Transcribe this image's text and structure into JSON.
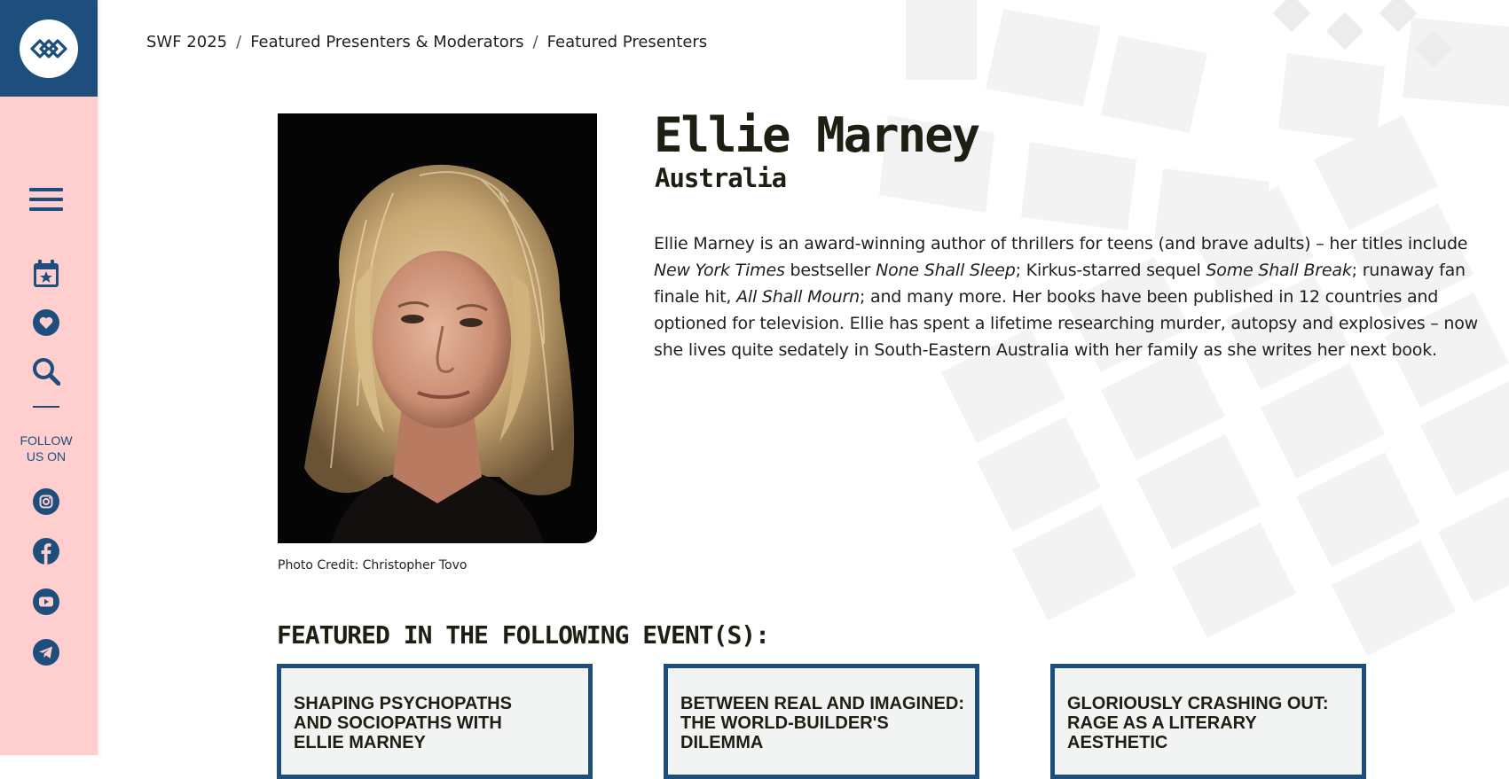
{
  "sidebar": {
    "logo_icon": "swf-logo-icon",
    "menu_icon": "hamburger-menu-icon",
    "icons": [
      "calendar-star-icon",
      "heart-icon",
      "search-icon"
    ],
    "follow_label": "FOLLOW\nUS ON",
    "social": [
      "instagram-icon",
      "facebook-icon",
      "youtube-icon",
      "telegram-icon"
    ],
    "colors": {
      "background": "#ffcece",
      "primary": "#1d4e7c"
    }
  },
  "breadcrumb": {
    "items": [
      "SWF 2025",
      "Featured Presenters & Moderators",
      "Featured Presenters"
    ],
    "separator": "/"
  },
  "presenter": {
    "name": "Ellie Marney",
    "country": "Australia",
    "photo_credit": "Photo Credit: Christopher Tovo",
    "bio_segments": [
      {
        "text": "Ellie Marney is an award-winning author of thrillers for teens (and brave adults) – her titles include ",
        "italic": false
      },
      {
        "text": "New York Times",
        "italic": true
      },
      {
        "text": " bestseller ",
        "italic": false
      },
      {
        "text": "None Shall Sleep",
        "italic": true
      },
      {
        "text": "; Kirkus-starred sequel ",
        "italic": false
      },
      {
        "text": "Some Shall Break",
        "italic": true
      },
      {
        "text": "; runaway fan finale hit, ",
        "italic": false
      },
      {
        "text": "All Shall Mourn",
        "italic": true
      },
      {
        "text": "; and many more. Her books have been published in 12 countries and optioned for television. Ellie has spent a lifetime researching murder, autopsy and explosives – now she lives quite sedately in South-Eastern Australia with her family as she writes her next book.",
        "italic": false
      }
    ]
  },
  "events": {
    "heading": "FEATURED IN THE FOLLOWING EVENT(S):",
    "cards": [
      {
        "title": "SHAPING PSYCHOPATHS AND SOCIOPATHS WITH ELLIE MARNEY"
      },
      {
        "title": "BETWEEN REAL AND IMAGINED: THE WORLD-BUILDER'S DILEMMA"
      },
      {
        "title": "GLORIOUSLY CRASHING OUT: RAGE AS A LITERARY AESTHETIC"
      }
    ]
  }
}
